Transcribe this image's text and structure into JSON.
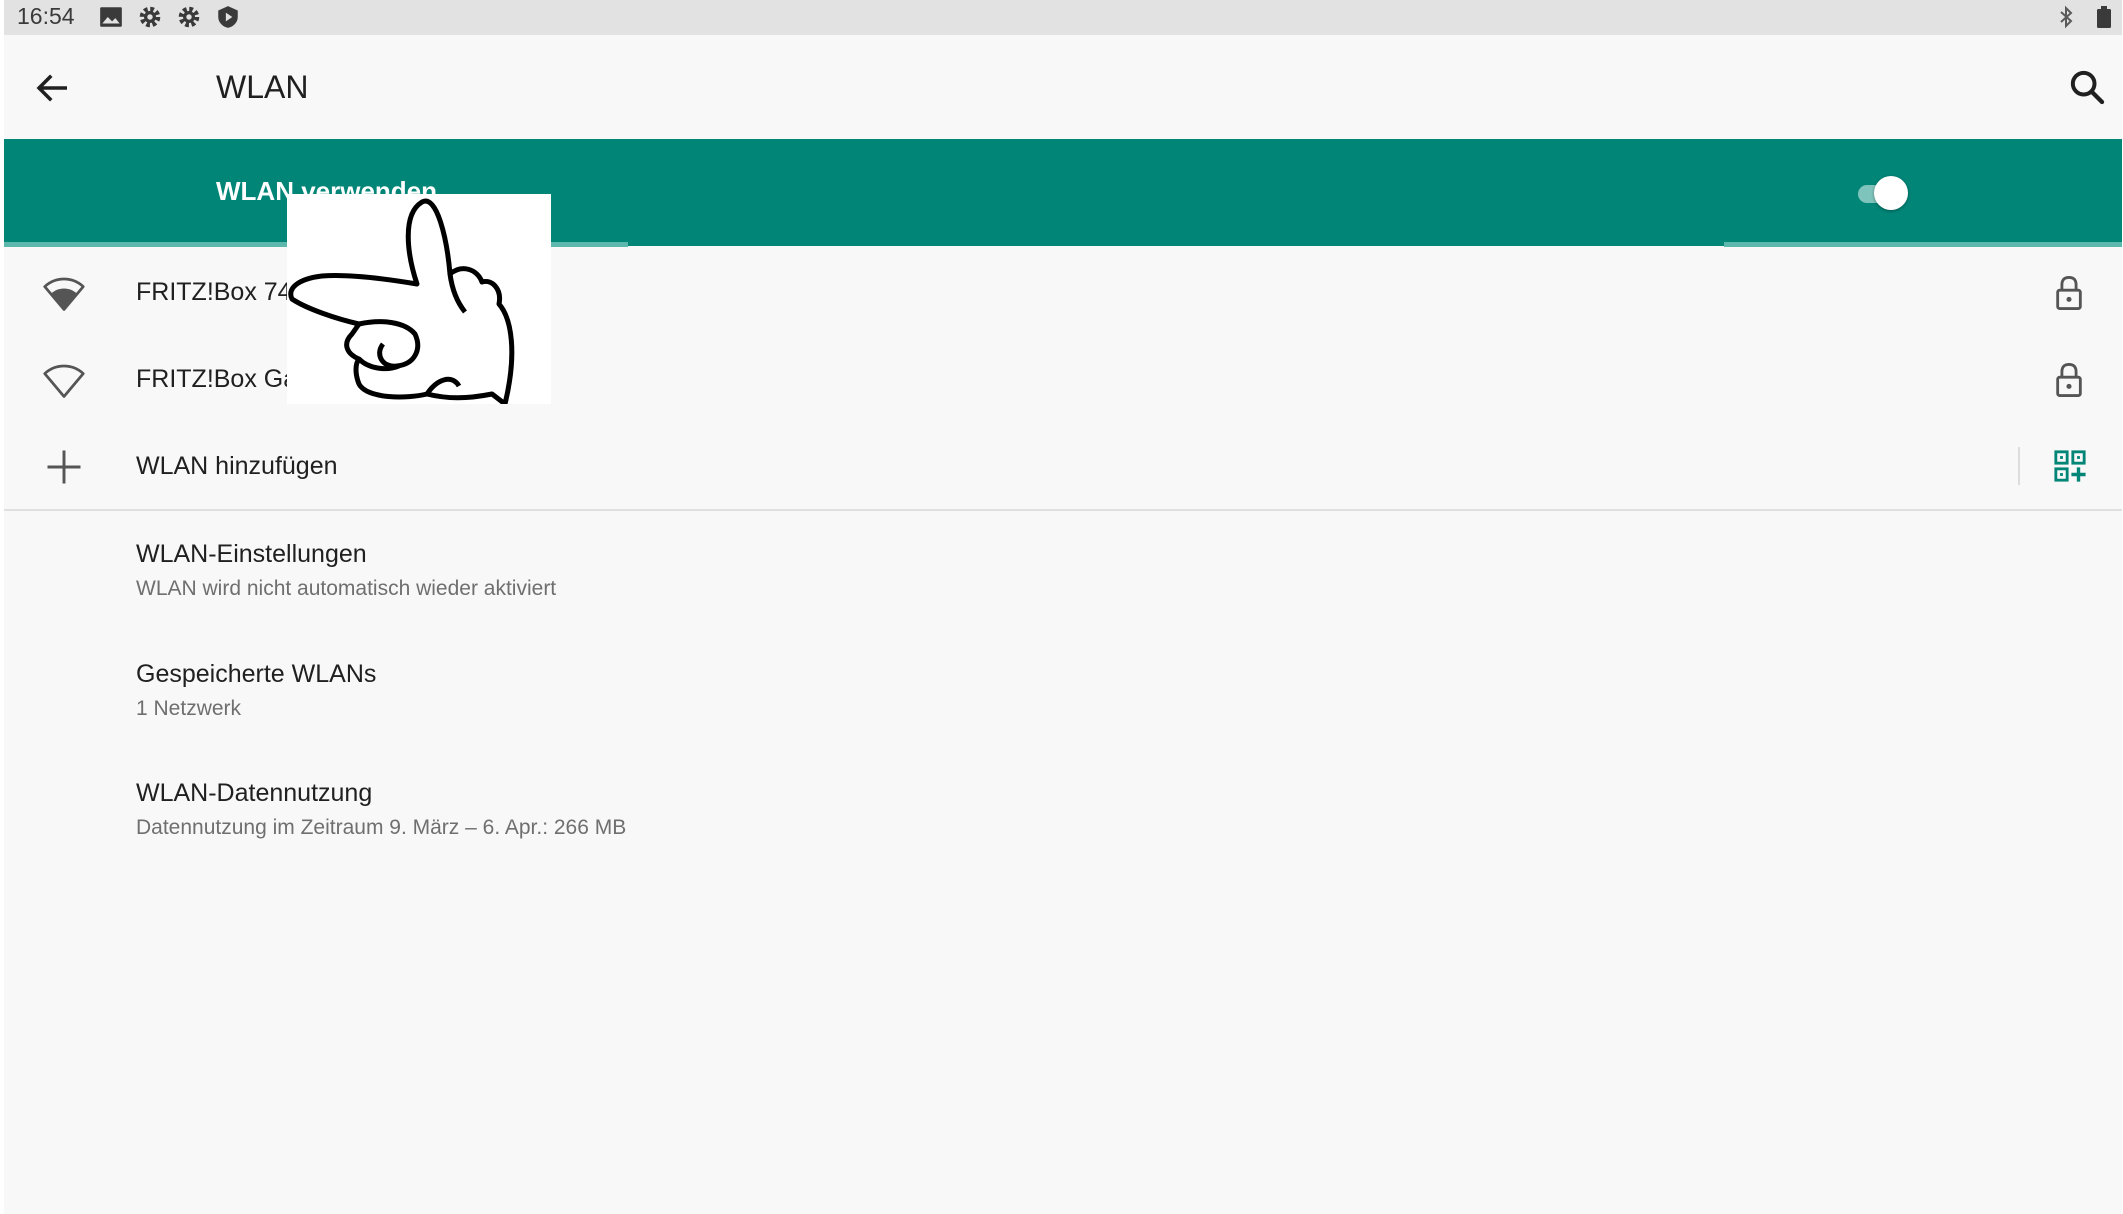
{
  "status_bar": {
    "time": "16:54",
    "left_icons": [
      "image-icon",
      "gear-icon",
      "gear-icon",
      "shield-icon"
    ],
    "right_icons": [
      "bluetooth-icon",
      "battery-icon"
    ]
  },
  "toolbar": {
    "title": "WLAN",
    "back_icon": "arrow-left-icon",
    "search_icon": "search-icon"
  },
  "master_switch": {
    "label": "WLAN verwenden",
    "enabled": true
  },
  "networks": [
    {
      "name": "FRITZ!Box 74",
      "signal": "full",
      "secured": true
    },
    {
      "name": "FRITZ!Box Ga",
      "signal": "outline",
      "secured": true
    }
  ],
  "add_network": {
    "label": "WLAN hinzufügen",
    "icon": "plus-icon",
    "qr_icon": "qr-code-add-icon"
  },
  "preferences": [
    {
      "title": "WLAN-Einstellungen",
      "summary": "WLAN wird nicht automatisch wieder aktiviert"
    },
    {
      "title": "Gespeicherte WLANs",
      "summary": "1 Netzwerk"
    },
    {
      "title": "WLAN-Datennutzung",
      "summary": "Datennutzung im Zeitraum 9. März – 6. Apr.: 266 MB"
    }
  ],
  "colors": {
    "accent": "#008577",
    "accent_light": "#5cb7ad",
    "background": "#f8f8f8",
    "status_bar": "#e2e2e2"
  }
}
